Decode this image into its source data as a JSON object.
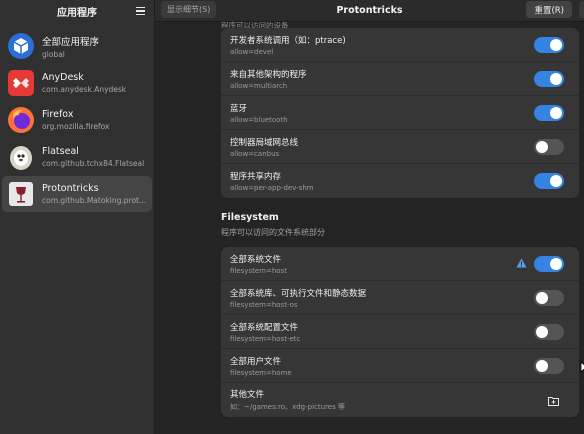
{
  "sidebar": {
    "title": "应用程序",
    "menu_icon": "hamburger-menu-icon",
    "apps": [
      {
        "name": "全部应用程序",
        "id": "global",
        "icon": "cube-icon",
        "color": "#2b6fd6"
      },
      {
        "name": "AnyDesk",
        "id": "com.anydesk.Anydesk",
        "icon": "anydesk-icon",
        "color": "#e53935"
      },
      {
        "name": "Firefox",
        "id": "org.mozilla.firefox",
        "icon": "firefox-icon",
        "color": "#ff7139"
      },
      {
        "name": "Flatseal",
        "id": "com.github.tchx84.Flatseal",
        "icon": "flatseal-icon",
        "color": "#d9d4c7"
      },
      {
        "name": "Protontricks",
        "id": "com.github.Matoking.prot…",
        "icon": "protontricks-icon",
        "color": "#8b1d2c"
      }
    ],
    "selected_index": 4
  },
  "header": {
    "show_details": "显示细节(S)",
    "title": "Protontricks",
    "reset": "重置(R)"
  },
  "cut_description": "程序可以访问的设备",
  "features": [
    {
      "title": "开发者系统调用（如：ptrace)",
      "sub": "allow=devel",
      "enabled": true
    },
    {
      "title": "来自其他架构的程序",
      "sub": "allow=multiarch",
      "enabled": true
    },
    {
      "title": "蓝牙",
      "sub": "allow=bluetooth",
      "enabled": true
    },
    {
      "title": "控制器局域网总线",
      "sub": "allow=canbus",
      "enabled": false
    },
    {
      "title": "程序共享内存",
      "sub": "allow=per-app-dev-shm",
      "enabled": true
    }
  ],
  "filesystem": {
    "title": "Filesystem",
    "description": "程序可以访问的文件系统部分",
    "rows": [
      {
        "title": "全部系统文件",
        "sub": "filesystem=host",
        "enabled": true,
        "warning": true
      },
      {
        "title": "全部系统库、可执行文件和静态数据",
        "sub": "filesystem=host-os",
        "enabled": false
      },
      {
        "title": "全部系统配置文件",
        "sub": "filesystem=host-etc",
        "enabled": false
      },
      {
        "title": "全部用户文件",
        "sub": "filesystem=home",
        "enabled": false
      }
    ],
    "other": {
      "title": "其他文件",
      "sub": "如：~/games:ro、xdg-pictures 等",
      "icon": "folder-add-icon"
    }
  },
  "colors": {
    "accent": "#3584e4",
    "warning": "#5aa0e8"
  }
}
